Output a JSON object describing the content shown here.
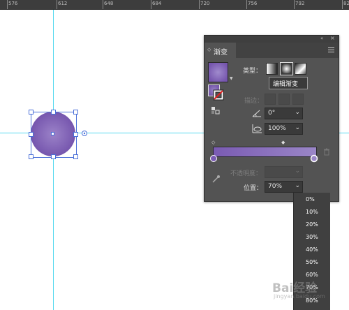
{
  "ruler": {
    "labels": [
      "576",
      "612",
      "648",
      "684",
      "720",
      "756",
      "792",
      "828"
    ]
  },
  "panel": {
    "title": "渐变",
    "collapse_icon": "double-chevron-left-icon",
    "close_icon": "close-icon",
    "menu_icon": "hamburger-menu-icon",
    "type_label": "类型：",
    "edit_gradient_label": "编辑渐变",
    "stroke_label": "描边：",
    "angle_value": "0°",
    "aspect_value": "100%",
    "opacity_label": "不透明度：",
    "position_label": "位置：",
    "position_value": "70%",
    "gradient_colors": {
      "start": "#7a5bb3",
      "end": "#9a86c7"
    }
  },
  "dropdown": {
    "options": [
      "0%",
      "10%",
      "20%",
      "30%",
      "40%",
      "50%",
      "60%",
      "70%",
      "80%"
    ]
  },
  "watermark": {
    "text": "Bai经验",
    "sub": "jingyan.baidu.com"
  }
}
